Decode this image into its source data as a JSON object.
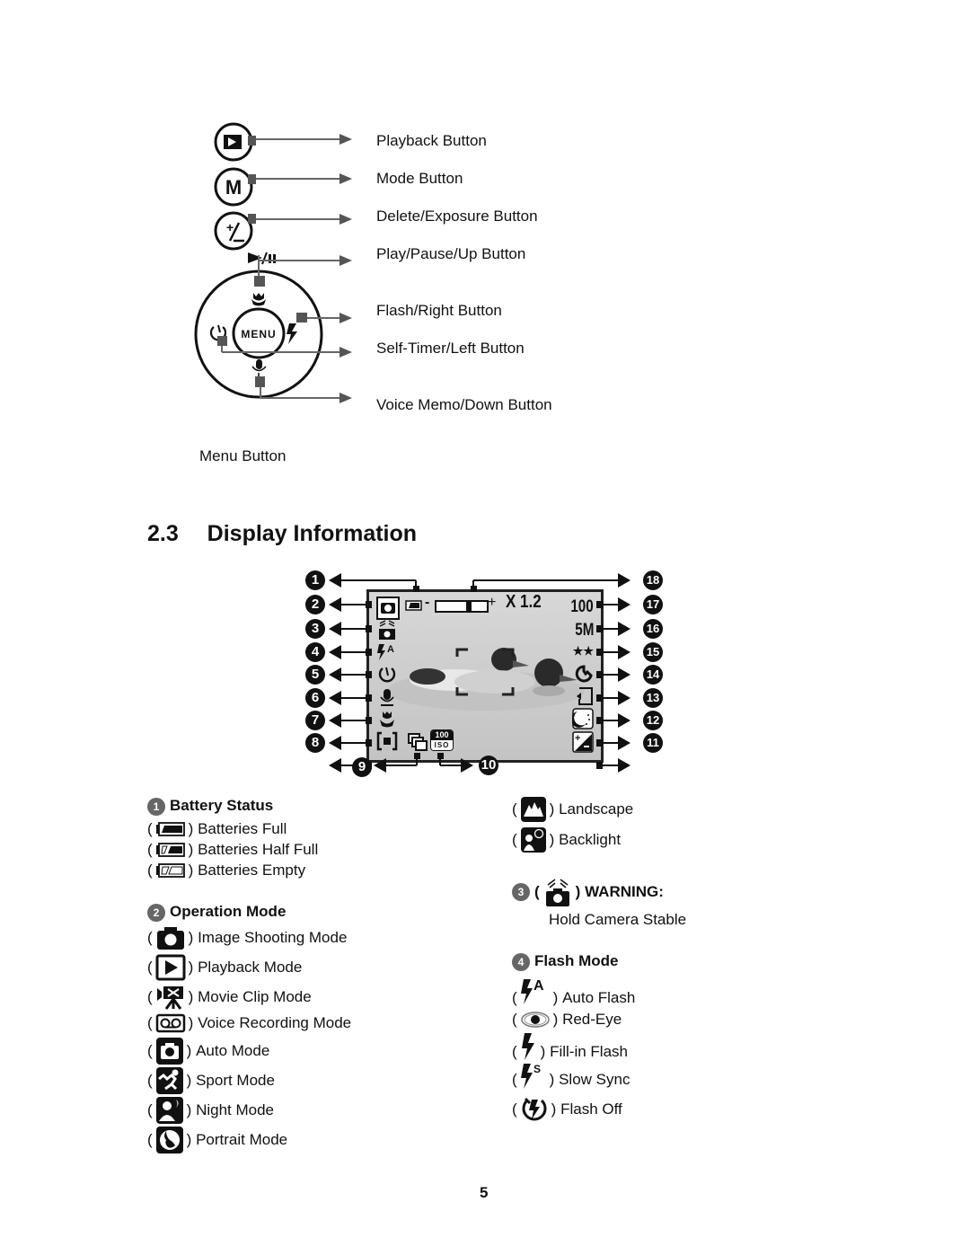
{
  "buttons_diagram": {
    "labels": [
      "Playback Button",
      "Mode Button",
      "Delete/Exposure Button",
      "Play/Pause/Up Button",
      "Flash/Right Button",
      "Self-Timer/Left Button",
      "Voice Memo/Down Button"
    ],
    "menu_label": "Menu Button",
    "mode_glyph": "M",
    "menu_glyph": "MENU",
    "icons": [
      "playback-icon",
      "mode-icon",
      "exposure-icon",
      "play-pause-icon",
      "macro-icon",
      "flash-icon",
      "self-timer-icon",
      "microphone-icon"
    ]
  },
  "section": {
    "number": "2.3",
    "title": "Display Information"
  },
  "lcd": {
    "zoom": "X 1.2",
    "shots_remaining": "100",
    "resolution": "5M",
    "quality": "★★",
    "iso_value": "100",
    "iso_label": "ISO",
    "zoom_minus": "-",
    "zoom_plus": "+",
    "zoom_level": 0.65,
    "callouts_left": [
      "1",
      "2",
      "3",
      "4",
      "5",
      "6",
      "7",
      "8"
    ],
    "callouts_right": [
      "18",
      "17",
      "16",
      "15",
      "14",
      "13",
      "12",
      "11"
    ],
    "callouts_bottom": [
      "9",
      "10"
    ]
  },
  "battery": {
    "num": "1",
    "title": "Battery Status",
    "items": [
      "Batteries Full",
      "Batteries Half Full",
      "Batteries Empty"
    ]
  },
  "operation": {
    "num": "2",
    "title": "Operation Mode",
    "items": [
      "Image Shooting Mode",
      "Playback Mode",
      "Movie Clip Mode",
      "Voice Recording Mode",
      "Auto Mode",
      "Sport Mode",
      "Night Mode",
      "Portrait Mode"
    ]
  },
  "scene_extra": {
    "items": [
      "Landscape",
      "Backlight"
    ]
  },
  "warning": {
    "num": "3",
    "title": "WARNING:",
    "text": "Hold Camera Stable"
  },
  "flash": {
    "num": "4",
    "title": "Flash Mode",
    "items": [
      "Auto Flash",
      "Red-Eye",
      "Fill-in Flash",
      "Slow Sync",
      "Flash Off"
    ]
  },
  "page_number": "5"
}
